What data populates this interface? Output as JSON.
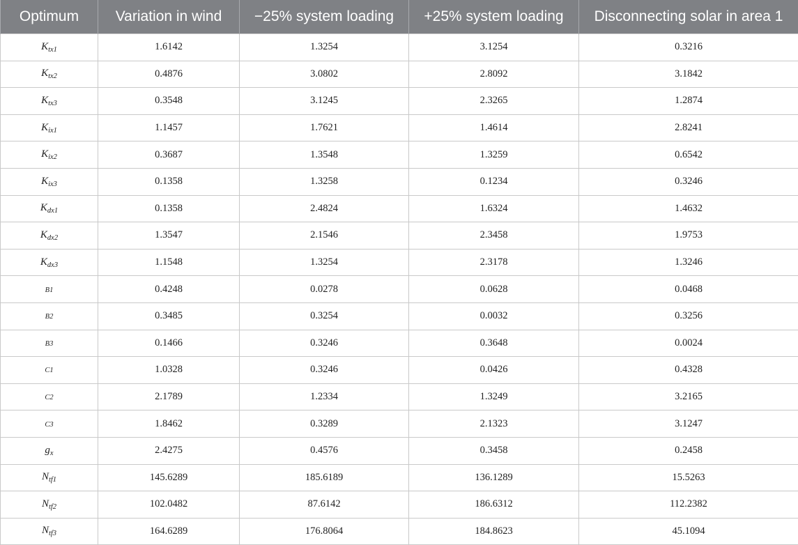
{
  "table": {
    "headers": [
      "Optimum",
      "Variation in wind",
      "−25% system loading",
      "+25% system loading",
      "Disconnecting solar in area 1"
    ],
    "rows": [
      {
        "label_base": "K",
        "label_sub": "tx1",
        "values": [
          "1.6142",
          "1.3254",
          "3.1254",
          "0.3216"
        ]
      },
      {
        "label_base": "K",
        "label_sub": "tx2",
        "values": [
          "0.4876",
          "3.0802",
          "2.8092",
          "3.1842"
        ]
      },
      {
        "label_base": "K",
        "label_sub": "tx3",
        "values": [
          "0.3548",
          "3.1245",
          "2.3265",
          "1.2874"
        ]
      },
      {
        "label_base": "K",
        "label_sub": "ix1",
        "values": [
          "1.1457",
          "1.7621",
          "1.4614",
          "2.8241"
        ]
      },
      {
        "label_base": "K",
        "label_sub": "ix2",
        "values": [
          "0.3687",
          "1.3548",
          "1.3259",
          "0.6542"
        ]
      },
      {
        "label_base": "K",
        "label_sub": "ix3",
        "values": [
          "0.1358",
          "1.3258",
          "0.1234",
          "0.3246"
        ]
      },
      {
        "label_base": "K",
        "label_sub": "dx1",
        "values": [
          "0.1358",
          "2.4824",
          "1.6324",
          "1.4632"
        ]
      },
      {
        "label_base": "K",
        "label_sub": "dx2",
        "values": [
          "1.3547",
          "2.1546",
          "2.3458",
          "1.9753"
        ]
      },
      {
        "label_base": "K",
        "label_sub": "dx3",
        "values": [
          "1.1548",
          "1.3254",
          "2.3178",
          "1.3246"
        ]
      },
      {
        "label_small": "B1",
        "values": [
          "0.4248",
          "0.0278",
          "0.0628",
          "0.0468"
        ]
      },
      {
        "label_small": "B2",
        "values": [
          "0.3485",
          "0.3254",
          "0.0032",
          "0.3256"
        ]
      },
      {
        "label_small": "B3",
        "values": [
          "0.1466",
          "0.3246",
          "0.3648",
          "0.0024"
        ]
      },
      {
        "label_small": "C1",
        "values": [
          "1.0328",
          "0.3246",
          "0.0426",
          "0.4328"
        ]
      },
      {
        "label_small": "C2",
        "values": [
          "2.1789",
          "1.2334",
          "1.3249",
          "3.2165"
        ]
      },
      {
        "label_small": "C3",
        "values": [
          "1.8462",
          "0.3289",
          "2.1323",
          "3.1247"
        ]
      },
      {
        "label_base": "g",
        "label_sub": "x",
        "values": [
          "2.4275",
          "0.4576",
          "0.3458",
          "0.2458"
        ]
      },
      {
        "label_base": "N",
        "label_sub": "tf1",
        "values": [
          "145.6289",
          "185.6189",
          "136.1289",
          "15.5263"
        ]
      },
      {
        "label_base": "N",
        "label_sub": "tf2",
        "values": [
          "102.0482",
          "87.6142",
          "186.6312",
          "112.2382"
        ]
      },
      {
        "label_base": "N",
        "label_sub": "tf3",
        "values": [
          "164.6289",
          "176.8064",
          "184.8623",
          "45.1094"
        ]
      }
    ]
  }
}
